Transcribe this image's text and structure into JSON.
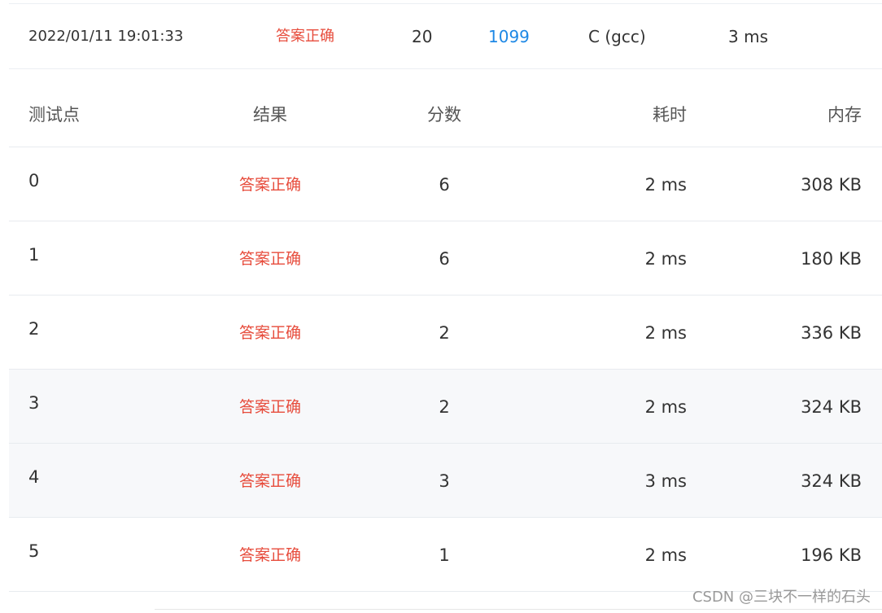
{
  "submission": {
    "time": "2022/01/11 19:01:33",
    "status": "答案正确",
    "score": "20",
    "problem": "1099",
    "language": "C (gcc)",
    "time_used": "3 ms"
  },
  "table": {
    "headers": {
      "case": "测试点",
      "result": "结果",
      "score": "分数",
      "time": "耗时",
      "memory": "内存"
    },
    "rows": [
      {
        "case": "0",
        "result": "答案正确",
        "score": "6",
        "time": "2 ms",
        "memory": "308 KB"
      },
      {
        "case": "1",
        "result": "答案正确",
        "score": "6",
        "time": "2 ms",
        "memory": "180 KB"
      },
      {
        "case": "2",
        "result": "答案正确",
        "score": "2",
        "time": "2 ms",
        "memory": "336 KB"
      },
      {
        "case": "3",
        "result": "答案正确",
        "score": "2",
        "time": "2 ms",
        "memory": "324 KB"
      },
      {
        "case": "4",
        "result": "答案正确",
        "score": "3",
        "time": "3 ms",
        "memory": "324 KB"
      },
      {
        "case": "5",
        "result": "答案正确",
        "score": "1",
        "time": "2 ms",
        "memory": "196 KB"
      }
    ]
  },
  "watermark": "CSDN @三块不一样的石头",
  "colors": {
    "accepted": "#e74c3c",
    "link": "#1e88e5",
    "shaded_row": "#f7f8fa"
  }
}
